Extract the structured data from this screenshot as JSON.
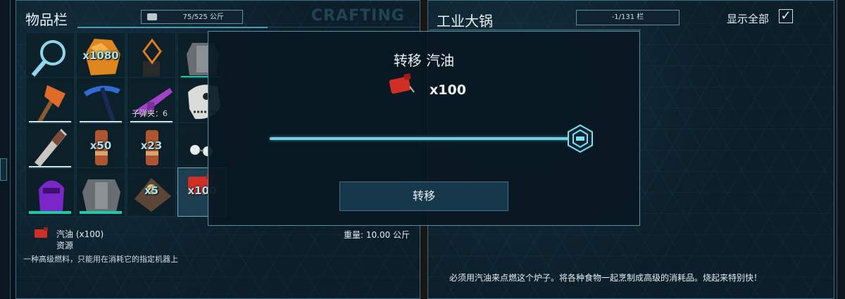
{
  "inventory": {
    "title": "物品栏",
    "weight": "75/525 公斤",
    "crafting_label": "CRAFTING",
    "slots": [
      {
        "icon": "magnifier-icon"
      },
      {
        "icon": "stone-icon",
        "qty": "x1080"
      },
      {
        "icon": "amulet-icon"
      },
      {
        "icon": "armor-icon"
      },
      {
        "icon": "axe-icon"
      },
      {
        "icon": "pickaxe-icon"
      },
      {
        "icon": "rifle-icon",
        "ammo": "子弹夹：6"
      },
      {
        "icon": "skull-icon"
      },
      {
        "icon": "drill-icon"
      },
      {
        "icon": "canister-icon",
        "qty": "x50"
      },
      {
        "icon": "canister-icon",
        "qty": "x23"
      },
      {
        "icon": "goggles-icon"
      },
      {
        "icon": "helmet-icon"
      },
      {
        "icon": "armor-icon"
      },
      {
        "icon": "ore-icon",
        "qty": "x5"
      },
      {
        "icon": "gasoline-icon",
        "qty": "x100"
      }
    ],
    "selected_item": {
      "name": "汽油 (x100)",
      "type": "资源",
      "weight": "重量: 10.00 公斤",
      "description": "一种高级燃料，只能用在消耗它的指定机器上"
    }
  },
  "cooker": {
    "title": "工业大锅",
    "slots": "-1/131 栏",
    "show_all_label": "显示全部",
    "show_all_checked": "✓",
    "description": "必须用汽油来点燃这个炉子。将各种食物一起烹制成高级的消耗品。烧起来特别快！"
  },
  "transfer_dialog": {
    "title": "转移 汽油",
    "quantity": "x100",
    "slider_fraction": 1.0,
    "button_label": "转移"
  }
}
